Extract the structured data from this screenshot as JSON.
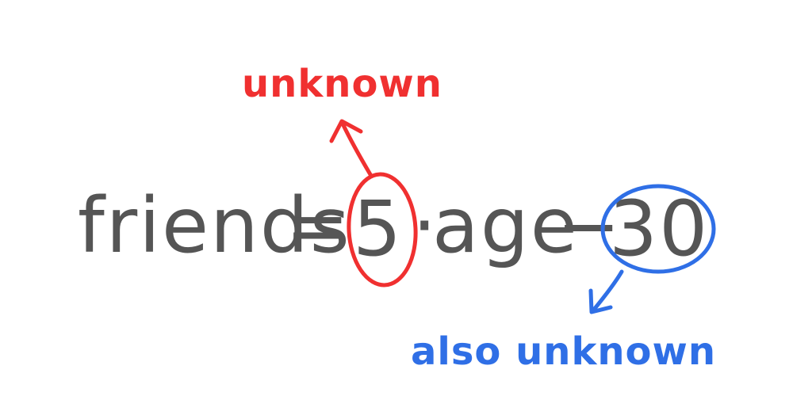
{
  "equation": {
    "lhs": "friends",
    "equals": "=",
    "coefficient": "5",
    "times": "·",
    "variable": "age",
    "minus": "−",
    "constant": "30"
  },
  "annotations": {
    "top": {
      "text": "unknown",
      "color": "#f03030"
    },
    "bottom": {
      "text": "also unknown",
      "color": "#2f6fe6"
    }
  },
  "colors": {
    "ink": "#555555",
    "red": "#f03030",
    "blue": "#2f6fe6",
    "background": "#ffffff"
  }
}
